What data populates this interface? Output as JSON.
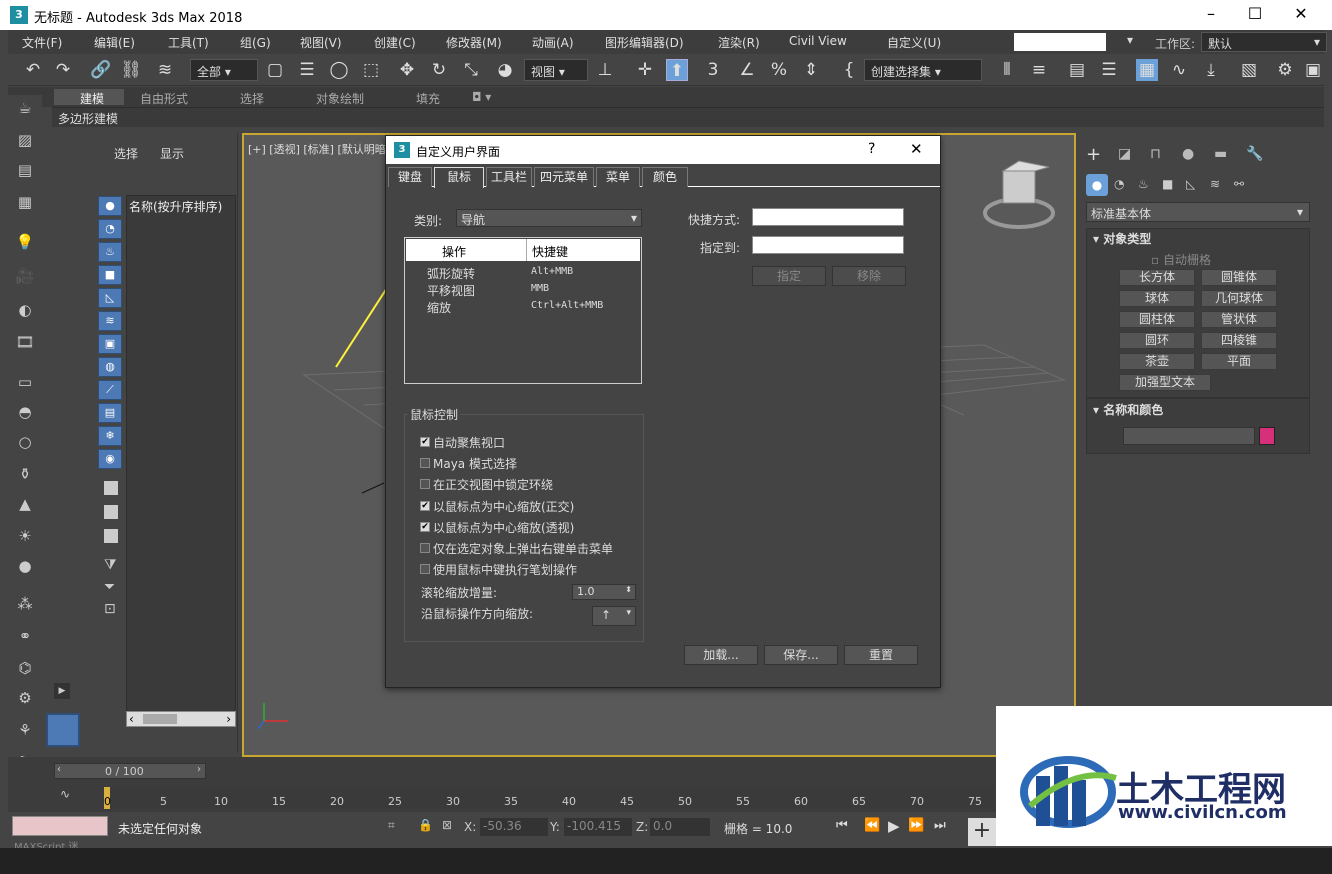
{
  "window": {
    "title": "无标题 - Autodesk 3ds Max 2018",
    "logo_glyph": "3"
  },
  "menu": [
    "文件(F)",
    "编辑(E)",
    "工具(T)",
    "组(G)",
    "视图(V)",
    "创建(C)",
    "修改器(M)",
    "动画(A)",
    "图形编辑器(D)",
    "渲染(R)",
    "Civil View",
    "自定义(U)"
  ],
  "workspace": {
    "label": "工作区:",
    "value": "默认"
  },
  "toolbar": {
    "filter": "全部",
    "viewsel": "视图",
    "selset": "创建选择集"
  },
  "ribbon": {
    "tabs": [
      "建模",
      "自由形式",
      "选择",
      "对象绘制",
      "填充"
    ],
    "sub": "多边形建模"
  },
  "explorer": {
    "select": "选择",
    "display": "显示",
    "header": "名称(按升序排序)"
  },
  "viewport": {
    "label": "[+] [透视] [标准] [默认明暗"
  },
  "dialog": {
    "title": "自定义用户界面",
    "help": "?",
    "close": "✕",
    "tabs": [
      "键盘",
      "鼠标",
      "工具栏",
      "四元菜单",
      "菜单",
      "颜色"
    ],
    "category_label": "类别:",
    "category_value": "导航",
    "table_headers": [
      "操作",
      "快捷键"
    ],
    "rows": [
      {
        "action": "弧形旋转",
        "key": "Alt+MMB"
      },
      {
        "action": "平移视图",
        "key": "MMB"
      },
      {
        "action": "缩放",
        "key": "Ctrl+Alt+MMB"
      }
    ],
    "shortcut_label": "快捷方式:",
    "assign_to_label": "指定到:",
    "assign_btn": "指定",
    "remove_btn": "移除",
    "mouse_group": "鼠标控制",
    "options": [
      {
        "label": "自动聚焦视口",
        "checked": true
      },
      {
        "label": "Maya 模式选择",
        "checked": false
      },
      {
        "label": "在正交视图中锁定环绕",
        "checked": false
      },
      {
        "label": "以鼠标点为中心缩放(正交)",
        "checked": true
      },
      {
        "label": "以鼠标点为中心缩放(透视)",
        "checked": true
      },
      {
        "label": "仅在选定对象上弹出右键单击菜单",
        "checked": false
      },
      {
        "label": "使用鼠标中键执行笔划操作",
        "checked": false
      }
    ],
    "wheel_label": "滚轮缩放增量:",
    "wheel_value": "1.0",
    "dir_label": "沿鼠标操作方向缩放:",
    "dir_value": "↑",
    "load_btn": "加载...",
    "save_btn": "保存...",
    "reset_btn": "重置"
  },
  "cmdpanel": {
    "dropdown": "标准基本体",
    "object_type": "对象类型",
    "autogrid": "自动栅格",
    "buttons": [
      "长方体",
      "圆锥体",
      "球体",
      "几何球体",
      "圆柱体",
      "管状体",
      "圆环",
      "四棱锥",
      "茶壶",
      "平面",
      "加强型文本"
    ],
    "name_color": "名称和颜色",
    "swatch_color": "#d6307a"
  },
  "timeline": {
    "frame": "0 / 100",
    "ticks": [
      "0",
      "5",
      "10",
      "15",
      "20",
      "25",
      "30",
      "35",
      "40",
      "45",
      "50",
      "55",
      "60",
      "65",
      "70",
      "75"
    ]
  },
  "status": {
    "msg": "未选定任何对象",
    "x_label": "X:",
    "x": "-50.36",
    "y_label": "Y:",
    "y": "-100.415",
    "z_label": "Z:",
    "z": "0.0",
    "grid": "栅格 = 10.0",
    "script": "MAXScript 迷"
  },
  "watermark": {
    "name": "土木工程网",
    "url": "www.civilcn.com"
  }
}
